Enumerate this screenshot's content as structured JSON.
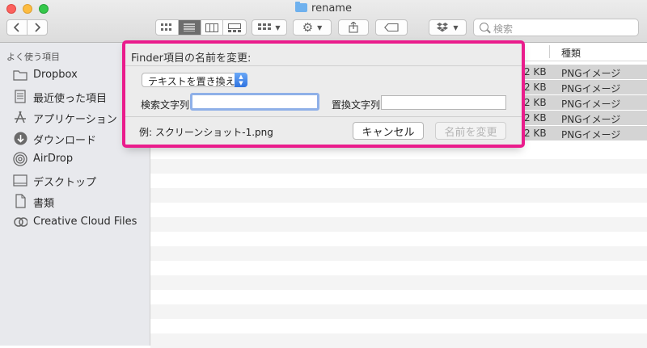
{
  "window": {
    "title": "rename",
    "traffic_colors": {
      "close": "#fc615d",
      "minimize": "#fdbc40",
      "zoom": "#34c84a"
    }
  },
  "toolbar": {
    "search_placeholder": "検索",
    "icons": [
      "back-icon",
      "forward-icon",
      "icon-view-icon",
      "list-view-icon",
      "column-view-icon",
      "gallery-view-icon",
      "arrange-icon",
      "action-gear-icon",
      "share-icon",
      "tag-icon",
      "dropbox-icon",
      "search-icon"
    ]
  },
  "sidebar": {
    "section_title": "よく使う項目",
    "items": [
      {
        "label": "Dropbox",
        "icon": "folder-icon"
      },
      {
        "label": "最近使った項目",
        "icon": "recents-icon"
      },
      {
        "label": "アプリケーション",
        "icon": "applications-icon"
      },
      {
        "label": "ダウンロード",
        "icon": "downloads-icon"
      },
      {
        "label": "AirDrop",
        "icon": "airdrop-icon"
      },
      {
        "label": "デスクトップ",
        "icon": "desktop-icon"
      },
      {
        "label": "書類",
        "icon": "documents-icon"
      },
      {
        "label": "Creative Cloud Files",
        "icon": "creative-cloud-icon"
      }
    ]
  },
  "file_list": {
    "kind_header": "種類",
    "rows": [
      {
        "size": "2 KB",
        "kind": "PNGイメージ"
      },
      {
        "size": "2 KB",
        "kind": "PNGイメージ"
      },
      {
        "size": "2 KB",
        "kind": "PNGイメージ"
      },
      {
        "size": "2 KB",
        "kind": "PNGイメージ"
      },
      {
        "size": "2 KB",
        "kind": "PNGイメージ"
      }
    ]
  },
  "rename_dialog": {
    "title": "Finder項目の名前を変更:",
    "mode_selected": "テキストを置き換える",
    "find_label": "検索文字列:",
    "find_value": "",
    "replace_label": "置換文字列:",
    "replace_value": "",
    "example": "例: スクリーンショット-1.png",
    "cancel_label": "キャンセル",
    "rename_label": "名前を変更",
    "highlight_color": "#ea1c8c"
  }
}
